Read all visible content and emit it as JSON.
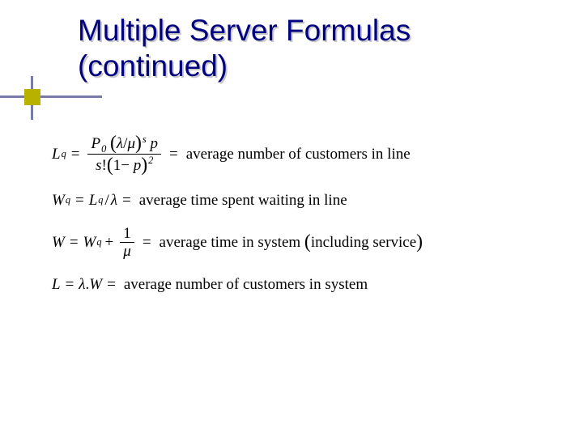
{
  "title": {
    "line1": "Multiple Server Formulas",
    "line2": "(continued)"
  },
  "chart_data": {
    "type": "table",
    "title": "Multiple Server Formulas (continued)",
    "formulas": [
      {
        "symbol": "L_q",
        "expression": "P_0 (λ/μ)^s p / ( s! (1 − p)^2 )",
        "description": "average number of customers in line"
      },
      {
        "symbol": "W_q",
        "expression": "L_q / λ",
        "description": "average time spent waiting in line"
      },
      {
        "symbol": "W",
        "expression": "W_q + 1/μ",
        "description": "average time in system (including service)"
      },
      {
        "symbol": "L",
        "expression": "λ W",
        "description": "average number of customers in system"
      }
    ]
  },
  "f1": {
    "lhs_var": "L",
    "lhs_sub": "q",
    "num_P": "P",
    "num_P_sub": "0",
    "num_lam": "λ",
    "num_slash": "/",
    "num_mu": "μ",
    "num_exp": "s",
    "num_p": "p",
    "den_s": "s",
    "den_fact": "!",
    "den_1": "1",
    "den_minus": "−",
    "den_p": "p",
    "den_exp": "2",
    "eq": "=",
    "desc": "average number of customers in line"
  },
  "f2": {
    "lhs_var": "W",
    "lhs_sub": "q",
    "rhs_L": "L",
    "rhs_L_sub": "q",
    "rhs_slash": "/",
    "rhs_lam": "λ",
    "eq": "=",
    "desc": "average time spent waiting in line"
  },
  "f3": {
    "lhs_var": "W",
    "rhs_W": "W",
    "rhs_W_sub": "q",
    "rhs_plus": "+",
    "frac_num": "1",
    "frac_den": "μ",
    "eq": "=",
    "desc_pre": "average time in system ",
    "desc_par": "including service",
    "paren_l": "(",
    "paren_r": ")"
  },
  "f4": {
    "lhs_var": "L",
    "rhs_lam": "λ",
    "rhs_dot": ".",
    "rhs_W": "W",
    "eq": "=",
    "desc": "average number of customers in system"
  }
}
